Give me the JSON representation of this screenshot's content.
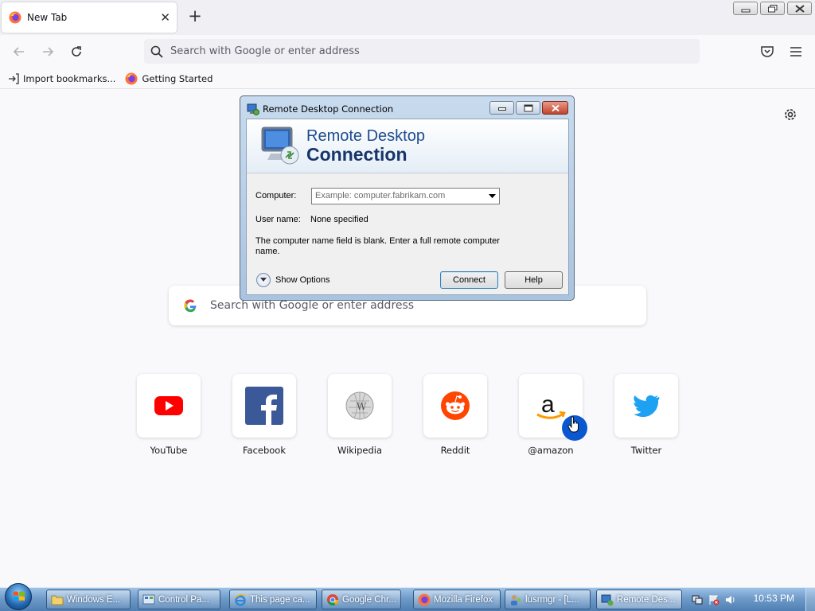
{
  "browser": {
    "tab": {
      "label": "New Tab",
      "close": "✕"
    },
    "new_tab": "+",
    "urlbar": {
      "placeholder": "Search with Google or enter address"
    },
    "bookmarks": [
      {
        "label": "Import bookmarks...",
        "icon": "import-icon"
      },
      {
        "label": "Getting Started",
        "icon": "firefox-icon"
      }
    ]
  },
  "newtab": {
    "search": {
      "placeholder": "Search with Google or enter address"
    },
    "tiles": [
      {
        "label": "YouTube",
        "icon": "youtube-icon"
      },
      {
        "label": "Facebook",
        "icon": "facebook-icon"
      },
      {
        "label": "Wikipedia",
        "icon": "wikipedia-icon"
      },
      {
        "label": "Reddit",
        "icon": "reddit-icon"
      },
      {
        "label": "@amazon",
        "icon": "amazon-icon"
      },
      {
        "label": "Twitter",
        "icon": "twitter-icon"
      }
    ]
  },
  "rdp": {
    "title": "Remote Desktop Connection",
    "banner_line1": "Remote Desktop",
    "banner_line2": "Connection",
    "computer_label": "Computer:",
    "computer_placeholder": "Example: computer.fabrikam.com",
    "username_label": "User name:",
    "username_value": "None specified",
    "message": "The computer name field is blank. Enter a full remote computer name.",
    "show_options": "Show Options",
    "connect": "Connect",
    "help": "Help"
  },
  "taskbar": {
    "items": [
      {
        "label": "Windows E...",
        "icon": "folder-icon"
      },
      {
        "label": "Control Pa...",
        "icon": "control-panel-icon"
      },
      {
        "label": "This page ca...",
        "icon": "ie-icon"
      },
      {
        "label": "Google Chr...",
        "icon": "chrome-icon"
      },
      {
        "label": "Mozilla Firefox",
        "icon": "firefox-icon"
      },
      {
        "label": "lusrmgr - [L...",
        "icon": "lusrmgr-icon"
      },
      {
        "label": "Remote Des...",
        "icon": "remote-desktop-icon"
      }
    ],
    "clock": "10:53 PM"
  },
  "colors": {
    "firefox_bg": "#f9f9fb",
    "taskbar": "#6f9bc9",
    "rdp_title_blue": "#17356a"
  }
}
